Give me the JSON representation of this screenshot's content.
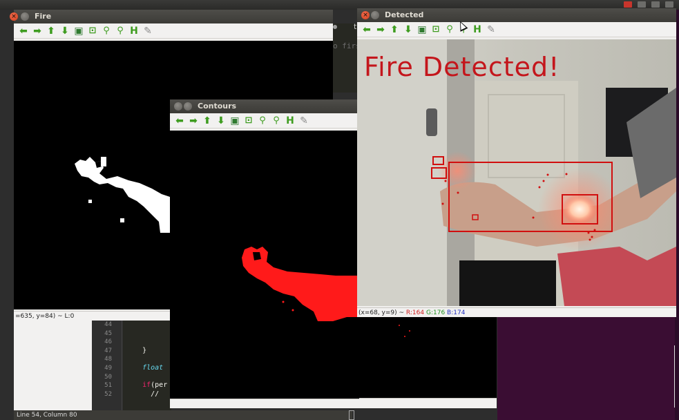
{
  "desktop": {
    "topbar_indicators": [
      "record-icon",
      "battery-icon",
      "network-icon",
      "clock-text"
    ]
  },
  "editor": {
    "ghost_text": "o firs",
    "tab_label": "t",
    "line_numbers": [
      "44",
      "45",
      "46",
      "47",
      "48",
      "49",
      "50",
      "51",
      "52"
    ],
    "code_lines": [
      "",
      "",
      "",
      "    }",
      "",
      "    float",
      "",
      "    if(per",
      "      // "
    ],
    "status_text": "Line 54, Column 80"
  },
  "windows": {
    "fire": {
      "title": "Fire",
      "status": "=635, y=84) ~ L:0"
    },
    "contours": {
      "title": "Contours"
    },
    "detected": {
      "title": "Detected",
      "overlay_text": "Fire Detected!",
      "status_prefix": "(x=68, y=9) ~ ",
      "status_r": "R:164",
      "status_g": "G:176",
      "status_b": "B:174"
    }
  },
  "toolbar_icons": [
    "arrow-left-icon",
    "arrow-right-icon",
    "arrow-up-icon",
    "arrow-down-icon",
    "image-icon",
    "zoom-fit-icon",
    "zoom-in-icon",
    "zoom-out-icon",
    "save-icon",
    "properties-brush-icon"
  ],
  "colors": {
    "detection_red": "#c4161c",
    "toolbar_green": "#3e9c1f",
    "mask_white": "#ffffff",
    "contour_red": "#ff1a1a"
  }
}
